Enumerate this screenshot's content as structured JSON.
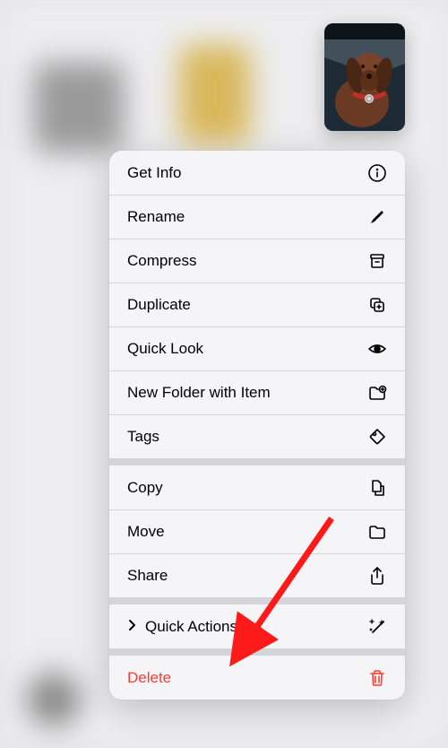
{
  "thumbnail": {
    "description": "dog-in-car-window"
  },
  "menu": {
    "groups": [
      {
        "items": [
          {
            "label": "Get Info",
            "icon": "info"
          },
          {
            "label": "Rename",
            "icon": "pencil"
          },
          {
            "label": "Compress",
            "icon": "archive"
          },
          {
            "label": "Duplicate",
            "icon": "duplicate"
          },
          {
            "label": "Quick Look",
            "icon": "eye"
          },
          {
            "label": "New Folder with Item",
            "icon": "folder-plus"
          },
          {
            "label": "Tags",
            "icon": "tag"
          }
        ]
      },
      {
        "items": [
          {
            "label": "Copy",
            "icon": "copy-docs"
          },
          {
            "label": "Move",
            "icon": "folder"
          },
          {
            "label": "Share",
            "icon": "share"
          }
        ]
      },
      {
        "items": [
          {
            "label": "Quick Actions",
            "icon": "sparkle-wand",
            "expandable": true
          }
        ]
      },
      {
        "items": [
          {
            "label": "Delete",
            "icon": "trash",
            "destructive": true
          }
        ]
      }
    ]
  },
  "annotation": {
    "arrow_color": "#ff1a1a",
    "target": "quick-actions"
  }
}
